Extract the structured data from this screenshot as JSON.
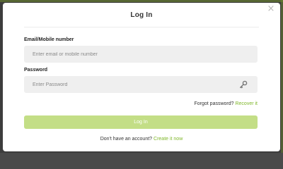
{
  "modal": {
    "title": "Log In",
    "close_symbol": "×"
  },
  "email": {
    "label": "Email/Mobile number",
    "placeholder": "Enter email or mobile number",
    "value": ""
  },
  "password": {
    "label": "Password",
    "placeholder": "Enter Password",
    "value": "",
    "toggle_icon": "key-icon"
  },
  "forgot": {
    "prompt": "Forgot password?",
    "link": "Recover it"
  },
  "submit": {
    "label": "Log In"
  },
  "signup": {
    "prompt": "Don't have an account?",
    "link": "Create it now"
  },
  "colors": {
    "accent": "#7fb72a",
    "button_disabled": "#c3de86",
    "field_bg": "#efefef"
  }
}
